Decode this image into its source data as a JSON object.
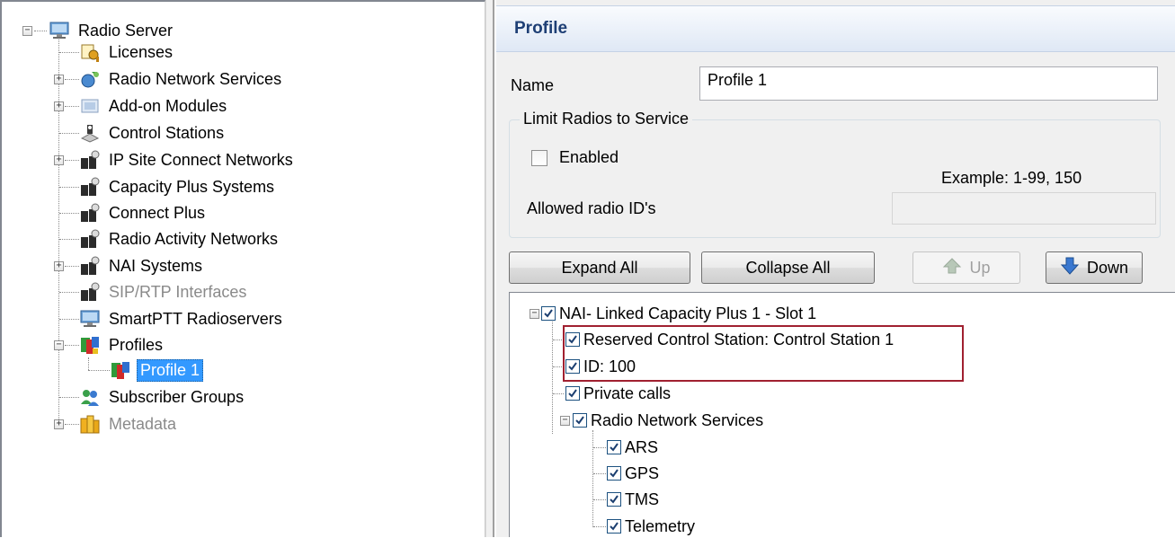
{
  "tree": {
    "root": "Radio Server",
    "items": [
      {
        "label": "Licenses",
        "icon": "licenses-icon",
        "expander": "",
        "disabled": false
      },
      {
        "label": "Radio Network Services",
        "icon": "radio-network-services-icon",
        "expander": "+",
        "disabled": false
      },
      {
        "label": "Add-on Modules",
        "icon": "addon-modules-icon",
        "expander": "+",
        "disabled": false
      },
      {
        "label": "Control Stations",
        "icon": "control-stations-icon",
        "expander": "",
        "disabled": false
      },
      {
        "label": "IP Site Connect Networks",
        "icon": "network-icon",
        "expander": "+",
        "disabled": false
      },
      {
        "label": "Capacity Plus Systems",
        "icon": "network-icon",
        "expander": "",
        "disabled": false
      },
      {
        "label": "Connect Plus",
        "icon": "network-icon",
        "expander": "",
        "disabled": false
      },
      {
        "label": "Radio Activity Networks",
        "icon": "network-icon",
        "expander": "",
        "disabled": false
      },
      {
        "label": "NAI Systems",
        "icon": "network-icon",
        "expander": "+",
        "disabled": false
      },
      {
        "label": "SIP/RTP Interfaces",
        "icon": "network-icon",
        "expander": "",
        "disabled": true
      },
      {
        "label": "SmartPTT Radioservers",
        "icon": "server-icon",
        "expander": "",
        "disabled": false
      },
      {
        "label": "Profiles",
        "icon": "profiles-icon",
        "expander": "-",
        "disabled": false
      },
      {
        "label": "Profile 1",
        "icon": "profile-icon",
        "expander": "",
        "disabled": false,
        "selected": true
      },
      {
        "label": "Subscriber Groups",
        "icon": "subscriber-groups-icon",
        "expander": "",
        "disabled": false
      },
      {
        "label": "Metadata",
        "icon": "metadata-icon",
        "expander": "+",
        "disabled": true
      }
    ]
  },
  "profile": {
    "header": "Profile",
    "name_label": "Name",
    "name_value": "Profile 1",
    "limit_group_label": "Limit Radios to Service",
    "enabled_label": "Enabled",
    "enabled_checked": false,
    "example_text": "Example: 1-99, 150",
    "allowed_ids_label": "Allowed radio ID's",
    "allowed_ids_value": ""
  },
  "buttons": {
    "expand_all": "Expand All",
    "collapse_all": "Collapse All",
    "up": "Up",
    "down": "Down"
  },
  "services": {
    "root": "NAI- Linked Capacity Plus 1 - Slot 1",
    "reserved": "Reserved Control Station: Control Station 1",
    "id": "ID: 100",
    "private_calls": "Private calls",
    "rns": "Radio Network Services",
    "ars": "ARS",
    "gps": "GPS",
    "tms": "TMS",
    "telemetry": "Telemetry"
  },
  "colors": {
    "selection": "#3399ff",
    "header_text": "#1e3f75",
    "highlight_border": "#a02030",
    "checkbox_border": "#1c5180"
  }
}
